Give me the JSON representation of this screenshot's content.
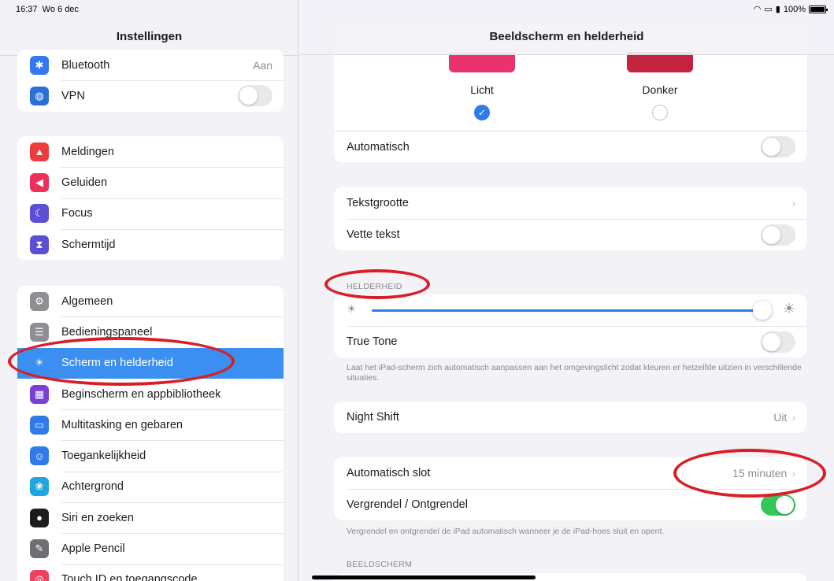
{
  "status": {
    "time": "16:37",
    "date": "Wo 6 dec",
    "battery": "100%"
  },
  "sidebar": {
    "title": "Instellingen",
    "group1": [
      {
        "label": "Bluetooth",
        "value": "Aan",
        "icon": "bluetooth-icon",
        "color": "#3478f6",
        "glyph": "✱"
      },
      {
        "label": "VPN",
        "toggle": false,
        "icon": "vpn-icon",
        "color": "#2c6fd6",
        "glyph": "◍"
      }
    ],
    "group2": [
      {
        "label": "Meldingen",
        "icon": "bell-icon",
        "color": "#ee3b3b",
        "glyph": "▲"
      },
      {
        "label": "Geluiden",
        "icon": "speaker-icon",
        "color": "#ed2f5a",
        "glyph": "◀"
      },
      {
        "label": "Focus",
        "icon": "moon-icon",
        "color": "#5b4fd6",
        "glyph": "☾"
      },
      {
        "label": "Schermtijd",
        "icon": "hourglass-icon",
        "color": "#5b4fd6",
        "glyph": "⧗"
      }
    ],
    "group3": [
      {
        "label": "Algemeen",
        "icon": "gear-icon",
        "color": "#8e8e93",
        "glyph": "⚙"
      },
      {
        "label": "Bedieningspaneel",
        "icon": "switches-icon",
        "color": "#8e8e93",
        "glyph": "☰"
      },
      {
        "label": "Scherm en helderheid",
        "icon": "sun-icon",
        "color": "#3b8ff0",
        "glyph": "☀",
        "selected": true
      },
      {
        "label": "Beginscherm en appbibliotheek",
        "icon": "grid-icon",
        "color": "#7a3fd8",
        "glyph": "▦"
      },
      {
        "label": "Multitasking en gebaren",
        "icon": "multitask-icon",
        "color": "#2f7be8",
        "glyph": "▭"
      },
      {
        "label": "Toegankelijkheid",
        "icon": "accessibility-icon",
        "color": "#2f7be8",
        "glyph": "☺"
      },
      {
        "label": "Achtergrond",
        "icon": "flower-icon",
        "color": "#1fa6e0",
        "glyph": "❀"
      },
      {
        "label": "Siri en zoeken",
        "icon": "siri-icon",
        "color": "#1c1c1e",
        "glyph": "●"
      },
      {
        "label": "Apple Pencil",
        "icon": "pencil-icon",
        "color": "#6e6e73",
        "glyph": "✎"
      },
      {
        "label": "Touch ID en toegangscode",
        "icon": "fingerprint-icon",
        "color": "#ef4060",
        "glyph": "◎"
      }
    ]
  },
  "main": {
    "title": "Beeldscherm en helderheid",
    "appearance": {
      "light": "Licht",
      "dark": "Donker",
      "light_color": "#e8336e",
      "dark_color": "#c4233f"
    },
    "automatisch": "Automatisch",
    "tekstgrootte": "Tekstgrootte",
    "vette_tekst": "Vette tekst",
    "helderheid_header": "HELDERHEID",
    "brightness_level": 0.96,
    "true_tone": "True Tone",
    "true_tone_footer": "Laat het iPad-scherm zich automatisch aanpassen aan het omgevingslicht zodat kleuren er hetzelfde uitzien in verschillende situaties.",
    "night_shift": "Night Shift",
    "night_shift_value": "Uit",
    "auto_lock": "Automatisch slot",
    "auto_lock_value": "15 minuten",
    "lock_unlock": "Vergrendel / Ontgrendel",
    "lock_footer": "Vergrendel en ontgrendel de iPad automatisch wanneer je de iPad-hoes sluit en opent.",
    "beeldscherm_header": "BEELDSCHERM"
  },
  "colors": {
    "accent": "#2f7be8",
    "selected": "#3b8ff0",
    "toggle_on": "#34c759",
    "annotation": "#d81f26"
  }
}
